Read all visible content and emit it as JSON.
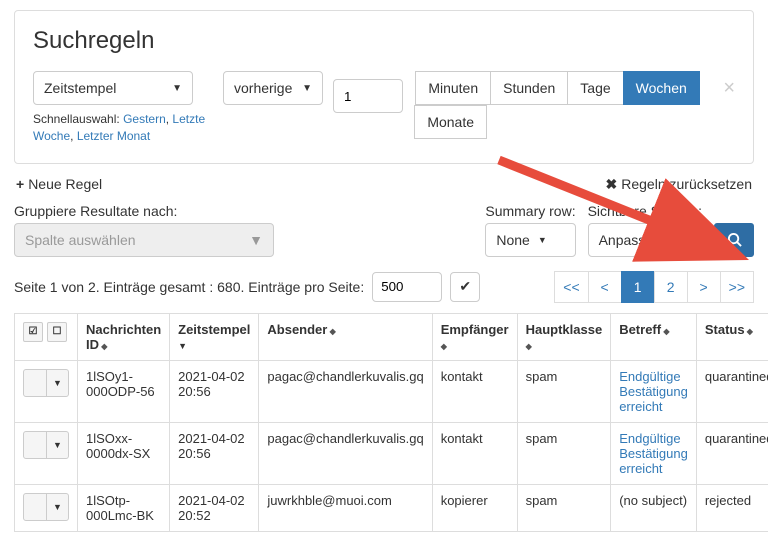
{
  "panel": {
    "title": "Suchregeln",
    "field_select": "Zeitstempel",
    "op_select": "vorherige",
    "num_value": "1",
    "units": [
      "Minuten",
      "Stunden",
      "Tage",
      "Wochen",
      "Monate"
    ],
    "active_unit": "Wochen",
    "quick_label": "Schnellauswahl:",
    "quick_links": [
      "Gestern",
      "Letzte Woche",
      "Letzter Monat"
    ]
  },
  "actions": {
    "new_rule": "Neue Regel",
    "reset": "Regeln zurücksetzen"
  },
  "filters": {
    "group_label": "Gruppiere Resultate nach:",
    "group_placeholder": "Spalte auswählen",
    "summary_label": "Summary row:",
    "summary_value": "None",
    "visible_label": "Sichtbare Spalten:",
    "visible_value": "Anpassen"
  },
  "pagination": {
    "info": "Seite 1 von 2. Einträge gesamt : 680. Einträge pro Seite:",
    "per_page": "500",
    "pages": [
      "<<",
      "<",
      "1",
      "2",
      ">",
      ">>"
    ],
    "active": "1"
  },
  "table": {
    "headers": [
      "Nachrichten ID",
      "Zeitstempel",
      "Absender",
      "Empfänger",
      "Hauptklasse",
      "Betreff",
      "Status"
    ],
    "rows": [
      {
        "id": "1lSOy1-000ODP-56",
        "ts": "2021-04-02 20:56",
        "sender": "pagac@chandlerkuvalis.gq",
        "recip": "kontakt",
        "cls": "spam",
        "subj": "Endgültige Bestätigung erreicht",
        "subj_link": true,
        "status": "quarantined"
      },
      {
        "id": "1lSOxx-0000dx-SX",
        "ts": "2021-04-02 20:56",
        "sender": "pagac@chandlerkuvalis.gq",
        "recip": "kontakt",
        "cls": "spam",
        "subj": "Endgültige Bestätigung erreicht",
        "subj_link": true,
        "status": "quarantined"
      },
      {
        "id": "1lSOtp-000Lmc-BK",
        "ts": "2021-04-02 20:52",
        "sender": "juwrkhble@muoi.com",
        "recip": "kopierer",
        "cls": "spam",
        "subj": "(no subject)",
        "subj_link": false,
        "status": "rejected"
      }
    ]
  }
}
